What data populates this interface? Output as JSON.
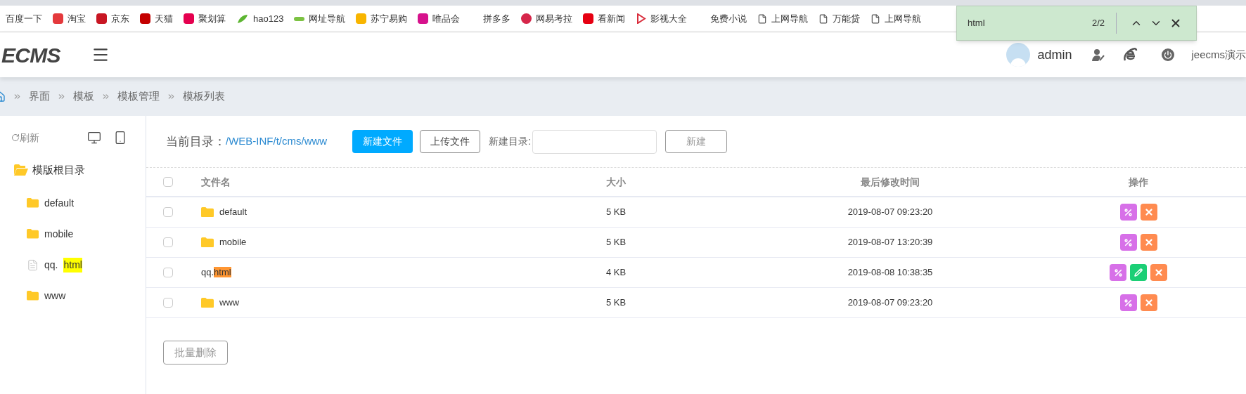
{
  "bookmarks": [
    {
      "label": "百度一下",
      "kind": "plain"
    },
    {
      "label": "淘宝",
      "kind": "site"
    },
    {
      "label": "京东",
      "kind": "site"
    },
    {
      "label": "天猫",
      "kind": "site"
    },
    {
      "label": "聚划算",
      "kind": "site"
    },
    {
      "label": "hao123",
      "kind": "leaf"
    },
    {
      "label": "网址导航",
      "kind": "bar"
    },
    {
      "label": "苏宁易购",
      "kind": "site"
    },
    {
      "label": "唯品会",
      "kind": "site"
    },
    {
      "label": "拼多多",
      "kind": "plain"
    },
    {
      "label": "网易考拉",
      "kind": "round"
    },
    {
      "label": "看新闻",
      "kind": "site"
    },
    {
      "label": "影视大全",
      "kind": "play"
    },
    {
      "label": "免费小说",
      "kind": "plain"
    },
    {
      "label": "上网导航",
      "kind": "page"
    },
    {
      "label": "万能贷",
      "kind": "page"
    },
    {
      "label": "上网导航",
      "kind": "page"
    }
  ],
  "find_bar": {
    "query": "html",
    "count": "2/2"
  },
  "header": {
    "logo": "ECMS",
    "user": "admin",
    "site": "jeecms演示"
  },
  "breadcrumb": [
    "界面",
    "模板",
    "模板管理",
    "模板列表"
  ],
  "sidebar": {
    "refresh": "刷新",
    "tree": {
      "label": "模版根目录",
      "expanded": true,
      "children": [
        {
          "label": "default",
          "kind": "folder"
        },
        {
          "label": "mobile",
          "kind": "folder"
        },
        {
          "label": "qq.",
          "highlight": "html",
          "kind": "file"
        },
        {
          "label": "www",
          "kind": "folder"
        }
      ]
    }
  },
  "toolbar": {
    "dir_label": "当前目录：",
    "dir_path": "/WEB-INF/t/cms/www",
    "new_file": "新建文件",
    "upload": "上传文件",
    "new_dir_label": "新建目录:",
    "create": "新建"
  },
  "table": {
    "select_all_checked": false,
    "columns": [
      "文件名",
      "大小",
      "最后修改时间",
      "操作"
    ],
    "rows": [
      {
        "name": "default",
        "kind": "folder",
        "checked": false,
        "size": "5 KB",
        "modified": "2019-08-07 09:23:20",
        "actions": [
          {
            "kind": "rename"
          },
          {
            "kind": "delete"
          }
        ]
      },
      {
        "name": "mobile",
        "kind": "folder",
        "checked": false,
        "size": "5 KB",
        "modified": "2019-08-07 13:20:39",
        "actions": [
          {
            "kind": "rename"
          },
          {
            "kind": "delete"
          }
        ]
      },
      {
        "name": "qq.",
        "highlight": "html",
        "highlight_current": true,
        "kind": "file",
        "checked": false,
        "size": "4 KB",
        "modified": "2019-08-08 10:38:35",
        "actions": [
          {
            "kind": "rename"
          },
          {
            "kind": "edit"
          },
          {
            "kind": "delete"
          }
        ]
      },
      {
        "name": "www",
        "kind": "folder",
        "checked": false,
        "size": "5 KB",
        "modified": "2019-08-07 09:23:20",
        "actions": [
          {
            "kind": "rename"
          },
          {
            "kind": "delete"
          }
        ]
      }
    ]
  },
  "bulk_delete": "批量删除"
}
